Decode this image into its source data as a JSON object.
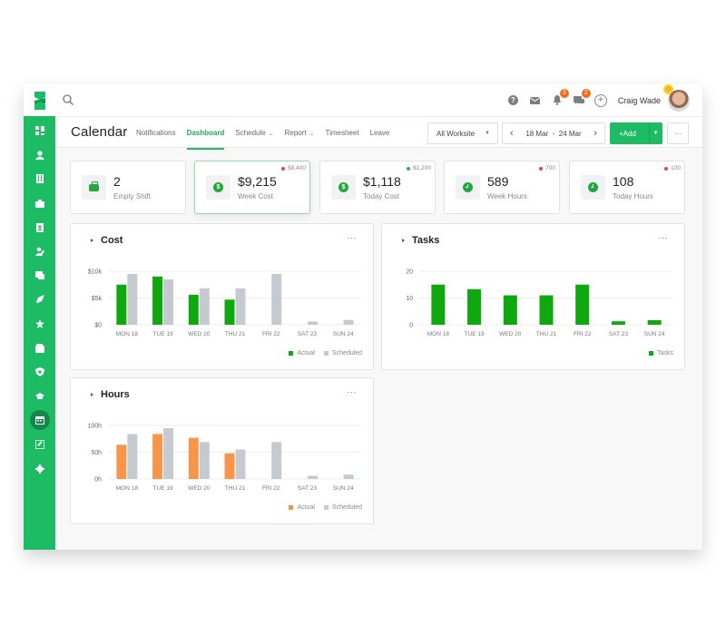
{
  "app": {
    "colors": {
      "brand": "#1dbb63",
      "actual_cost": "#0fa80f",
      "scheduled": "#c4cad0",
      "actual_hours": "#f7954a",
      "badge": "#f26b1d"
    }
  },
  "topbar": {
    "search_icon": "search-icon",
    "icons": [
      {
        "name": "help-icon"
      },
      {
        "name": "mail-icon"
      },
      {
        "name": "bell-icon",
        "badge": "3"
      },
      {
        "name": "chat-icon",
        "badge": "2"
      },
      {
        "name": "add-circle-icon",
        "glyph": "+"
      }
    ],
    "user_name": "Craig Wade"
  },
  "sidebar": {
    "items": [
      {
        "name": "dashboard-icon"
      },
      {
        "name": "user-icon"
      },
      {
        "name": "book-icon"
      },
      {
        "name": "briefcase-icon"
      },
      {
        "name": "contact-card-icon"
      },
      {
        "name": "user-edit-icon"
      },
      {
        "name": "chat-icon"
      },
      {
        "name": "rocket-icon"
      },
      {
        "name": "star-icon"
      },
      {
        "name": "wallet-icon"
      },
      {
        "name": "shield-icon"
      },
      {
        "name": "graduation-cap-icon"
      },
      {
        "name": "calendar-icon",
        "active": true
      },
      {
        "name": "edit-icon"
      },
      {
        "name": "gear-icon"
      }
    ]
  },
  "subnav": {
    "title": "Calendar",
    "tabs": [
      {
        "label": "Notifications",
        "active": false,
        "dropdown": false
      },
      {
        "label": "Dashboard",
        "active": true,
        "dropdown": false
      },
      {
        "label": "Schedule",
        "active": false,
        "dropdown": true
      },
      {
        "label": "Report",
        "active": false,
        "dropdown": true
      },
      {
        "label": "Timesheet",
        "active": false,
        "dropdown": false
      },
      {
        "label": "Leave",
        "active": false,
        "dropdown": false
      }
    ],
    "worksite": "All Worksite",
    "date_range": "18 Mar  -  24 Mar",
    "add_label": "+Add",
    "more_label": "···"
  },
  "stats": [
    {
      "value": "2",
      "label": "Empty Shift",
      "icon": "briefcase-icon",
      "delta": "",
      "delta_color": ""
    },
    {
      "value": "$9,215",
      "label": "Week Cost",
      "icon": "dollar-icon",
      "delta": "$8,400",
      "delta_color": "#e0405c",
      "highlight": true
    },
    {
      "value": "$1,118",
      "label": "Today Cost",
      "icon": "dollar-icon",
      "delta": "$1,200",
      "delta_color": "#1dbb63"
    },
    {
      "value": "589",
      "label": "Week Hours",
      "icon": "clock-icon",
      "delta": "700",
      "delta_color": "#e0405c"
    },
    {
      "value": "108",
      "label": "Today Hours",
      "icon": "clock-icon",
      "delta": "100",
      "delta_color": "#e0405c"
    }
  ],
  "cards": {
    "cost_title": "Cost",
    "tasks_title": "Tasks",
    "hours_title": "Hours",
    "more": "···"
  },
  "chart_data": [
    {
      "type": "bar",
      "title": "Cost",
      "categories": [
        "MON 18",
        "TUE 19",
        "WED 20",
        "THU 21",
        "FRI 22",
        "SAT 23",
        "SUN 24"
      ],
      "series": [
        {
          "name": "Actual",
          "color": "#0fa80f",
          "values": [
            7500,
            9000,
            5600,
            4700,
            0,
            0,
            0
          ]
        },
        {
          "name": "Scheduled",
          "color": "#c4cad0",
          "values": [
            9500,
            8500,
            6800,
            6800,
            9500,
            600,
            900
          ]
        }
      ],
      "yticks": [
        "$0",
        "$5k",
        "$10k"
      ],
      "ytick_values": [
        0,
        5000,
        10000
      ],
      "ylim": [
        0,
        10000
      ],
      "grid": true,
      "legend": "bottom-right"
    },
    {
      "type": "bar",
      "title": "Tasks",
      "categories": [
        "MON 18",
        "TUE 19",
        "WED 20",
        "THU 21",
        "FRI 22",
        "SAT 23",
        "SUN 24"
      ],
      "series": [
        {
          "name": "Tasks",
          "color": "#0fa80f",
          "values": [
            15,
            13.3,
            11,
            11,
            15,
            1.3,
            1.7
          ]
        }
      ],
      "yticks": [
        "0",
        "10",
        "20"
      ],
      "ytick_values": [
        0,
        10,
        20
      ],
      "ylim": [
        0,
        20
      ],
      "grid": true,
      "legend": "bottom-right"
    },
    {
      "type": "bar",
      "title": "Hours",
      "categories": [
        "MON 18",
        "TUE 19",
        "WED 20",
        "THU 21",
        "FRI 22",
        "SAT 23",
        "SUN 24"
      ],
      "series": [
        {
          "name": "Actual",
          "color": "#f7954a",
          "values": [
            64,
            84,
            77,
            48,
            0,
            0,
            0
          ]
        },
        {
          "name": "Scheduled",
          "color": "#c4cad0",
          "values": [
            84,
            95,
            69,
            55,
            69,
            6,
            8
          ]
        }
      ],
      "yticks": [
        "0h",
        "50h",
        "100h"
      ],
      "ytick_values": [
        0,
        50,
        100
      ],
      "ylim": [
        0,
        100
      ],
      "grid": true,
      "legend": "bottom-right"
    }
  ]
}
